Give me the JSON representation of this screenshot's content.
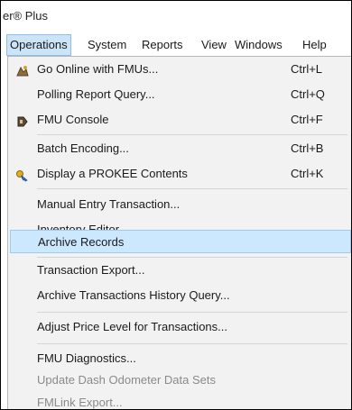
{
  "window": {
    "title": "er® Plus"
  },
  "menubar": {
    "items": [
      {
        "label": "Operations"
      },
      {
        "label": "System"
      },
      {
        "label": "Reports"
      },
      {
        "label": "View"
      },
      {
        "label": "Windows"
      },
      {
        "label": "Help"
      }
    ]
  },
  "operations_menu": {
    "items": [
      {
        "label": "Go Online with FMUs...",
        "shortcut": "Ctrl+L",
        "icon": "online-icon"
      },
      {
        "label": "Polling Report Query...",
        "shortcut": "Ctrl+Q"
      },
      {
        "label": "FMU Console",
        "shortcut": "Ctrl+F",
        "icon": "console-icon"
      },
      {
        "label": "Batch Encoding...",
        "shortcut": "Ctrl+B"
      },
      {
        "label": "Display a PROKEE Contents",
        "shortcut": "Ctrl+K",
        "icon": "key-icon"
      },
      {
        "label": "Manual Entry Transaction..."
      },
      {
        "label": "Inventory Editor..."
      },
      {
        "label": "Archive Records",
        "highlighted": true
      },
      {
        "label": "Transaction Export..."
      },
      {
        "label": "Archive Transactions History Query..."
      },
      {
        "label": "Adjust Price Level for Transactions..."
      },
      {
        "label": "FMU Diagnostics..."
      },
      {
        "label": "Update Dash Odometer Data Sets",
        "disabled": true
      },
      {
        "label": "FMLink Export...",
        "disabled": true
      }
    ]
  }
}
